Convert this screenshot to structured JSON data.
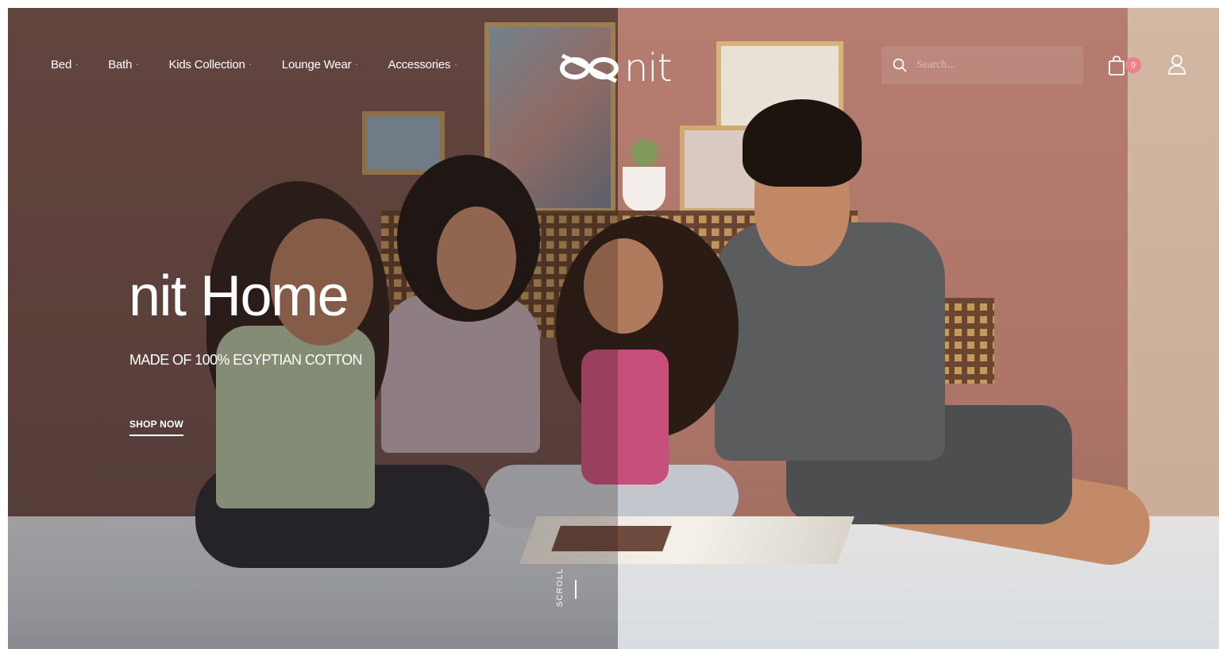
{
  "nav": {
    "items": [
      {
        "label": "Bed",
        "arrow": "·"
      },
      {
        "label": "Bath",
        "arrow": "·"
      },
      {
        "label": "Kids Collection",
        "arrow": "·"
      },
      {
        "label": "Lounge Wear",
        "arrow": "·"
      },
      {
        "label": "Accessories",
        "arrow": "·"
      }
    ]
  },
  "logo": {
    "text": "nit",
    "icon": "oxo-knot-logo"
  },
  "search": {
    "placeholder": "Search...",
    "icon": "search-icon"
  },
  "cart": {
    "icon": "shopping-bag-icon",
    "count": "0",
    "badge_color": "#e9828a"
  },
  "account": {
    "icon": "user-icon"
  },
  "hero": {
    "title": "nit Home",
    "subtitle": "MADE OF 100% EGYPTIAN COTTON",
    "cta": "SHOP NOW",
    "scroll_label": "SCROLL"
  },
  "colors": {
    "wall_left": "#6f4e48",
    "wall_right": "#ad7568",
    "text": "#ffffff"
  }
}
